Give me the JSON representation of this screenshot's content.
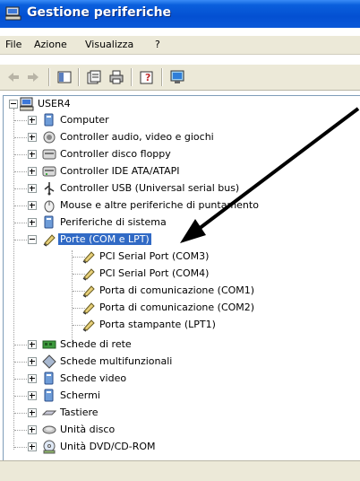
{
  "window": {
    "title": "Gestione periferiche"
  },
  "menu": [
    "File",
    "Azione",
    "Visualizza",
    "?"
  ],
  "toolbar": {
    "buttons": [
      "back-arrow-icon",
      "forward-arrow-icon",
      "console-tree-icon",
      "properties-icon",
      "print-icon",
      "help-icon",
      "scan-hardware-icon"
    ]
  },
  "tree": {
    "root": "USER4",
    "categories": [
      {
        "label": "Computer",
        "icon": "computer-icon"
      },
      {
        "label": "Controller audio, video e giochi",
        "icon": "speaker-icon"
      },
      {
        "label": "Controller disco floppy",
        "icon": "floppy-controller-icon"
      },
      {
        "label": "Controller IDE ATA/ATAPI",
        "icon": "ide-controller-icon"
      },
      {
        "label": "Controller USB (Universal serial bus)",
        "icon": "usb-icon"
      },
      {
        "label": "Mouse e altre periferiche di puntamento",
        "icon": "mouse-icon"
      },
      {
        "label": "Periferiche di sistema",
        "icon": "system-device-icon"
      },
      {
        "label": "Porte (COM e LPT)",
        "icon": "port-icon",
        "selected": true,
        "expanded": true,
        "children": [
          "PCI Serial Port (COM3)",
          "PCI Serial Port (COM4)",
          "Porta di comunicazione (COM1)",
          "Porta di comunicazione (COM2)",
          "Porta stampante (LPT1)"
        ]
      },
      {
        "label": "Schede di rete",
        "icon": "network-card-icon"
      },
      {
        "label": "Schede multifunzionali",
        "icon": "multifunction-icon"
      },
      {
        "label": "Schede video",
        "icon": "display-adapter-icon"
      },
      {
        "label": "Schermi",
        "icon": "monitor-icon"
      },
      {
        "label": "Tastiere",
        "icon": "keyboard-icon"
      },
      {
        "label": "Unità disco",
        "icon": "disk-drive-icon"
      },
      {
        "label": "Unità DVD/CD-ROM",
        "icon": "dvd-drive-icon"
      }
    ]
  }
}
